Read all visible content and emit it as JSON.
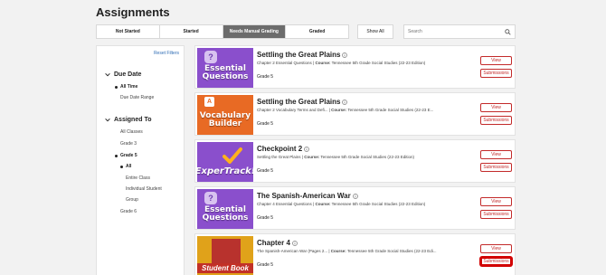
{
  "page": {
    "title": "Assignments"
  },
  "tabs": [
    {
      "label": "Not Started",
      "active": false
    },
    {
      "label": "Started",
      "active": false
    },
    {
      "label": "Needs Manual Grading",
      "active": true
    },
    {
      "label": "Graded",
      "active": false
    }
  ],
  "toolbar": {
    "show_all_label": "Show All",
    "search_placeholder": "Search"
  },
  "sidebar": {
    "reset_label": "Reset Filters",
    "due_date": {
      "title": "Due Date",
      "options": [
        "All Time",
        "Due Date Range"
      ]
    },
    "assigned_to": {
      "title": "Assigned To",
      "options": [
        "All Classes",
        "Grade 3",
        "Grade 5",
        "All",
        "Entire Class",
        "Individual Student",
        "Group",
        "Grade 6"
      ]
    }
  },
  "assignments": [
    {
      "thumb_text": "Essential Questions",
      "title": "Settling the Great Plains",
      "chapter": "Chapter 2 Essential Questions",
      "course_label": "Course:",
      "course": "Tennessee 5th Grade Social Studies (22-23 Edition)",
      "grade": "Grade 5",
      "view_label": "View",
      "submissions_label": "Submissions"
    },
    {
      "thumb_text": "Vocabulary Builder",
      "title": "Settling the Great Plains",
      "chapter": "Chapter 2 Vocabulary Terms and Defi...",
      "course_label": "Course:",
      "course": "Tennessee 5th Grade Social Studies (22-23 E...",
      "grade": "Grade 5",
      "view_label": "View",
      "submissions_label": "Submissions"
    },
    {
      "thumb_text": "ExperTrack!",
      "title": "Checkpoint 2",
      "chapter": "Settling the Great Plains",
      "course_label": "Course:",
      "course": "Tennessee 5th Grade Social Studies (22-23 Edition)",
      "grade": "Grade 5",
      "view_label": "View",
      "submissions_label": "Submissions"
    },
    {
      "thumb_text": "Essential Questions",
      "title": "The Spanish-American War",
      "chapter": "Chapter 4 Essential Questions",
      "course_label": "Course:",
      "course": "Tennessee 5th Grade Social Studies (22-23 Edition)",
      "grade": "Grade 5",
      "view_label": "View",
      "submissions_label": "Submissions"
    },
    {
      "thumb_text": "Student Book",
      "title": "Chapter 4",
      "chapter": "The Spanish-American War (Pages 2...",
      "course_label": "Course:",
      "course": "Tennessee 5th Grade Social Studies (22-23 Edi...",
      "grade": "Grade 5",
      "view_label": "View",
      "submissions_label": "Submissions"
    }
  ],
  "colors": {
    "accent_red": "#c32a2a",
    "active_tab": "#6c6c6c",
    "link_blue": "#2f6db5",
    "eq_purple": "#8a4fcc",
    "vocab_orange": "#e86a24"
  },
  "icons": [
    "search-icon",
    "chevron-down-icon",
    "info-icon",
    "question-icon",
    "checkmark-icon"
  ]
}
